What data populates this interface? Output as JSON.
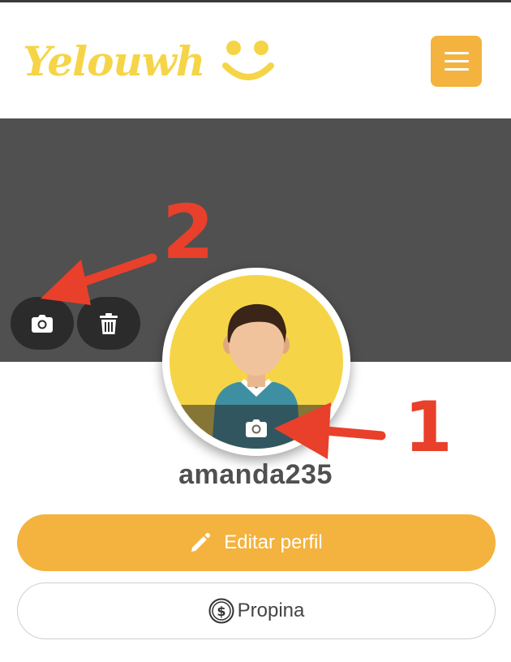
{
  "header": {
    "logo_text": "Yelouwh",
    "menu_icon": "hamburger-icon"
  },
  "cover": {
    "camera_icon": "camera-icon",
    "delete_icon": "trash-icon"
  },
  "profile": {
    "username": "amanda235",
    "avatar_icon": "person-avatar",
    "avatar_camera_icon": "camera-icon"
  },
  "actions": {
    "edit_label": "Editar perfil",
    "edit_icon": "pencil-icon",
    "tip_label": "Propina",
    "tip_icon": "dollar-coin-icon"
  },
  "annotations": {
    "label_1": "1",
    "label_2": "2"
  },
  "colors": {
    "accent": "#f3b33e",
    "logo_yellow": "#f5d547",
    "cover_gray": "#505050",
    "annotation_red": "#e8402b"
  }
}
